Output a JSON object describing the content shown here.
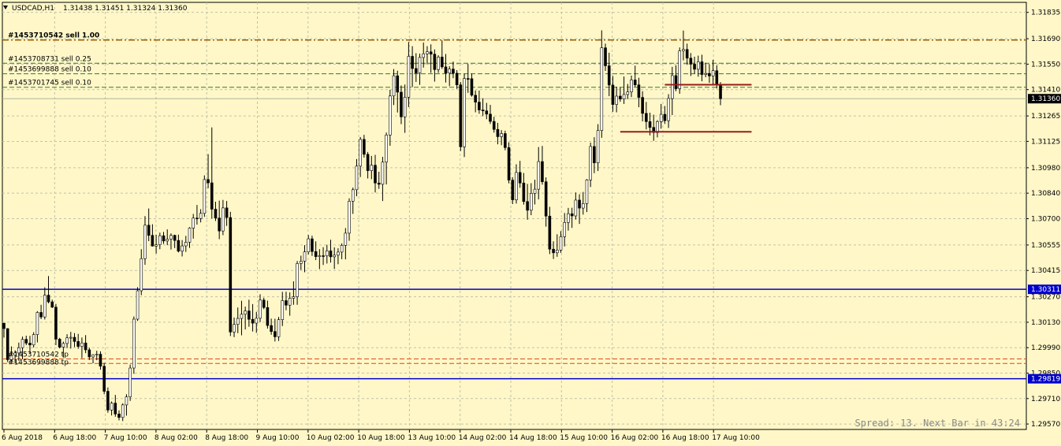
{
  "header": {
    "symbol_label": "USDCAD,H1",
    "ohlc_text": "1.31438 1.31451 1.31324 1.31360"
  },
  "status": {
    "spread_text": "Spread: 13. Next Bar in 43:24"
  },
  "colors": {
    "background": "#fff7c8",
    "grid": "#c2c2a8",
    "candle": "#000000",
    "support_line": "#0000cc",
    "sell_main_line": "#9a5a00",
    "sell_small_line": "#2f7d2f",
    "tp_line": "#d84a1a",
    "box_line": "#9b1b1b",
    "price_tag_blue": "#0000cc",
    "price_tag_black": "#000000"
  },
  "chart_data": {
    "type": "candlestick",
    "title": "USDCAD,H1",
    "ylim": [
      1.2954,
      1.3189
    ],
    "y_ticks": [
      "1.31835",
      "1.31690",
      "1.31550",
      "1.31410",
      "1.31265",
      "1.31125",
      "1.30980",
      "1.30840",
      "1.30700",
      "1.30555",
      "1.30415",
      "1.30270",
      "1.30130",
      "1.29990",
      "1.29850",
      "1.29710",
      "1.29570"
    ],
    "x_ticks": [
      "6 Aug 2018",
      "6 Aug 18:00",
      "7 Aug 10:00",
      "8 Aug 02:00",
      "8 Aug 18:00",
      "9 Aug 10:00",
      "10 Aug 02:00",
      "10 Aug 18:00",
      "13 Aug 10:00",
      "14 Aug 02:00",
      "14 Aug 18:00",
      "15 Aug 10:00",
      "16 Aug 02:00",
      "16 Aug 18:00",
      "17 Aug 10:00"
    ],
    "current_price": "1.31360",
    "horizontal_levels": [
      {
        "label": "",
        "price": 1.30311,
        "price_label": "1.30311",
        "kind": "support"
      },
      {
        "label": "",
        "price": 1.29819,
        "price_label": "1.29819",
        "kind": "support"
      },
      {
        "label": "#1453710542 sell 1.00",
        "price": 1.31683,
        "kind": "sell_main"
      },
      {
        "label": "#1453708731 sell 0.25",
        "price": 1.31555,
        "kind": "sell_small"
      },
      {
        "label": "#1453699888 sell 0.10",
        "price": 1.31497,
        "kind": "sell_small"
      },
      {
        "label": "#1453701745 sell 0.10",
        "price": 1.31423,
        "kind": "sell_small"
      },
      {
        "label": "#1453710542 tp",
        "price": 1.29928,
        "kind": "tp"
      },
      {
        "label": "#1453699888 tp",
        "price": 1.29903,
        "kind": "tp"
      }
    ],
    "segments": [
      {
        "x_start_bar": 178,
        "x_end_bar": 195,
        "price": 1.31437
      },
      {
        "x_start_bar": 166,
        "x_end_bar": 195,
        "price": 1.31178
      }
    ],
    "candles": [
      [
        1.30125,
        1.30115,
        1.30045,
        1.30095
      ],
      [
        1.30095,
        1.30097,
        1.29911,
        1.29924
      ],
      [
        1.29924,
        1.29997,
        1.29913,
        1.29949
      ],
      [
        1.29949,
        1.29975,
        1.29904,
        1.29961
      ],
      [
        1.29961,
        1.30018,
        1.29918,
        1.2999
      ],
      [
        1.2999,
        1.30051,
        1.29926,
        1.30036
      ],
      [
        1.30036,
        1.30056,
        1.30004,
        1.30015
      ],
      [
        1.30015,
        1.30055,
        1.29955,
        1.30005
      ],
      [
        1.30005,
        1.30075,
        1.29991,
        1.30062
      ],
      [
        1.30062,
        1.30191,
        1.30019,
        1.30184
      ],
      [
        1.30184,
        1.30226,
        1.30147,
        1.30159
      ],
      [
        1.30159,
        1.30322,
        1.30145,
        1.30279
      ],
      [
        1.30279,
        1.30384,
        1.30234,
        1.30242
      ],
      [
        1.30242,
        1.30254,
        1.30208,
        1.30213
      ],
      [
        1.30213,
        1.30231,
        1.30004,
        1.30037
      ],
      [
        1.30037,
        1.30044,
        1.29986,
        1.29993
      ],
      [
        1.29993,
        1.30023,
        1.29935,
        1.30013
      ],
      [
        1.30013,
        1.30064,
        1.29988,
        1.30044
      ],
      [
        1.30044,
        1.30077,
        1.29985,
        1.30047
      ],
      [
        1.30047,
        1.3007,
        1.29993,
        1.30024
      ],
      [
        1.30024,
        1.30066,
        1.29984,
        1.29997
      ],
      [
        1.29997,
        1.30046,
        1.29932,
        1.30016
      ],
      [
        1.30016,
        1.30059,
        1.2996,
        1.29978
      ],
      [
        1.29978,
        1.29989,
        1.29922,
        1.29939
      ],
      [
        1.29939,
        1.29954,
        1.29904,
        1.29951
      ],
      [
        1.29951,
        1.29973,
        1.29921,
        1.29954
      ],
      [
        1.29954,
        1.2997,
        1.29869,
        1.29888
      ],
      [
        1.29888,
        1.29906,
        1.29734,
        1.2975
      ],
      [
        1.2975,
        1.29771,
        1.29632,
        1.29647
      ],
      [
        1.29647,
        1.29694,
        1.29617,
        1.29685
      ],
      [
        1.29685,
        1.2973,
        1.2961,
        1.29625
      ],
      [
        1.29625,
        1.29645,
        1.2959,
        1.29606
      ],
      [
        1.29606,
        1.29684,
        1.29586,
        1.29675
      ],
      [
        1.29675,
        1.29734,
        1.29616,
        1.29719
      ],
      [
        1.29719,
        1.29897,
        1.29697,
        1.29878
      ],
      [
        1.29878,
        1.30162,
        1.29846,
        1.30147
      ],
      [
        1.30147,
        1.30323,
        1.30137,
        1.30303
      ],
      [
        1.30303,
        1.30532,
        1.30279,
        1.3048
      ],
      [
        1.3048,
        1.30714,
        1.30446,
        1.30664
      ],
      [
        1.30664,
        1.30756,
        1.30576,
        1.30608
      ],
      [
        1.30608,
        1.30669,
        1.30547,
        1.30549
      ],
      [
        1.30549,
        1.30611,
        1.30508,
        1.30556
      ],
      [
        1.30556,
        1.30623,
        1.30532,
        1.30606
      ],
      [
        1.30606,
        1.30627,
        1.30561,
        1.30577
      ],
      [
        1.30577,
        1.30641,
        1.30554,
        1.30587
      ],
      [
        1.30587,
        1.30619,
        1.3053,
        1.30608
      ],
      [
        1.30608,
        1.30612,
        1.30538,
        1.3058
      ],
      [
        1.3058,
        1.30612,
        1.30514,
        1.30521
      ],
      [
        1.30521,
        1.30582,
        1.30492,
        1.3055
      ],
      [
        1.3055,
        1.30605,
        1.30517,
        1.3057
      ],
      [
        1.3057,
        1.30653,
        1.30539,
        1.30648
      ],
      [
        1.30648,
        1.30726,
        1.3059,
        1.30703
      ],
      [
        1.30703,
        1.30775,
        1.30667,
        1.30701
      ],
      [
        1.30701,
        1.30752,
        1.30679,
        1.30729
      ],
      [
        1.30729,
        1.30938,
        1.3071,
        1.30915
      ],
      [
        1.30915,
        1.31055,
        1.30867,
        1.30897
      ],
      [
        1.30897,
        1.31202,
        1.30701,
        1.30752
      ],
      [
        1.30752,
        1.30793,
        1.30687,
        1.30703
      ],
      [
        1.30703,
        1.30799,
        1.30587,
        1.30632
      ],
      [
        1.30632,
        1.30803,
        1.30609,
        1.30759
      ],
      [
        1.30759,
        1.30797,
        1.3066,
        1.30706
      ],
      [
        1.30706,
        1.30738,
        1.30054,
        1.30076
      ],
      [
        1.30076,
        1.30156,
        1.30048,
        1.30118
      ],
      [
        1.30118,
        1.30211,
        1.3007,
        1.30151
      ],
      [
        1.30151,
        1.30248,
        1.30058,
        1.30174
      ],
      [
        1.30174,
        1.30216,
        1.3009,
        1.30192
      ],
      [
        1.30192,
        1.30254,
        1.30105,
        1.30146
      ],
      [
        1.30146,
        1.3023,
        1.30079,
        1.30125
      ],
      [
        1.30125,
        1.30187,
        1.30072,
        1.30152
      ],
      [
        1.30152,
        1.30284,
        1.30131,
        1.30252
      ],
      [
        1.30252,
        1.30265,
        1.30202,
        1.30211
      ],
      [
        1.30211,
        1.30249,
        1.30095,
        1.30112
      ],
      [
        1.30112,
        1.3015,
        1.30061,
        1.30079
      ],
      [
        1.30079,
        1.30149,
        1.30024,
        1.3005
      ],
      [
        1.3005,
        1.30159,
        1.30027,
        1.30144
      ],
      [
        1.30144,
        1.30297,
        1.30109,
        1.30249
      ],
      [
        1.30249,
        1.30298,
        1.30196,
        1.30224
      ],
      [
        1.30224,
        1.30294,
        1.30166,
        1.30262
      ],
      [
        1.30262,
        1.30355,
        1.30226,
        1.3027
      ],
      [
        1.3027,
        1.30467,
        1.30226,
        1.30453
      ],
      [
        1.30453,
        1.30496,
        1.30418,
        1.30466
      ],
      [
        1.30466,
        1.30554,
        1.30405,
        1.30517
      ],
      [
        1.30517,
        1.3061,
        1.30503,
        1.30589
      ],
      [
        1.30589,
        1.30606,
        1.30495,
        1.30519
      ],
      [
        1.30519,
        1.30575,
        1.30472,
        1.30491
      ],
      [
        1.30491,
        1.30532,
        1.30422,
        1.30496
      ],
      [
        1.30496,
        1.30543,
        1.30445,
        1.30495
      ],
      [
        1.30495,
        1.30556,
        1.30453,
        1.30523
      ],
      [
        1.30523,
        1.30584,
        1.30458,
        1.3049
      ],
      [
        1.3049,
        1.30542,
        1.30423,
        1.30499
      ],
      [
        1.30499,
        1.30537,
        1.30449,
        1.30516
      ],
      [
        1.30516,
        1.30564,
        1.30477,
        1.30553
      ],
      [
        1.30553,
        1.30648,
        1.30476,
        1.3062
      ],
      [
        1.3062,
        1.30812,
        1.30578,
        1.30796
      ],
      [
        1.30796,
        1.30871,
        1.30726,
        1.30859
      ],
      [
        1.30859,
        1.31028,
        1.30823,
        1.30989
      ],
      [
        1.30989,
        1.31149,
        1.30929,
        1.31136
      ],
      [
        1.31136,
        1.31161,
        1.31036,
        1.31054
      ],
      [
        1.31054,
        1.31067,
        1.30921,
        1.30964
      ],
      [
        1.30964,
        1.31045,
        1.30917,
        1.30994
      ],
      [
        1.30994,
        1.31051,
        1.30844,
        1.30896
      ],
      [
        1.30896,
        1.30958,
        1.30864,
        1.30889
      ],
      [
        1.30889,
        1.3104,
        1.30797,
        1.31011
      ],
      [
        1.31011,
        1.31174,
        1.30888,
        1.3116
      ],
      [
        1.3116,
        1.31409,
        1.31101,
        1.31375
      ],
      [
        1.31375,
        1.31523,
        1.31325,
        1.31486
      ],
      [
        1.31486,
        1.31514,
        1.31284,
        1.31396
      ],
      [
        1.31396,
        1.31433,
        1.3122,
        1.3126
      ],
      [
        1.3126,
        1.31438,
        1.31172,
        1.31368
      ],
      [
        1.31368,
        1.31672,
        1.31314,
        1.31593
      ],
      [
        1.31593,
        1.31649,
        1.31424,
        1.31526
      ],
      [
        1.31526,
        1.3161,
        1.31452,
        1.31502
      ],
      [
        1.31502,
        1.31608,
        1.31436,
        1.31587
      ],
      [
        1.31587,
        1.31669,
        1.31531,
        1.31607
      ],
      [
        1.31607,
        1.31649,
        1.31549,
        1.31618
      ],
      [
        1.31618,
        1.31659,
        1.31502,
        1.31605
      ],
      [
        1.31605,
        1.31631,
        1.31454,
        1.3152
      ],
      [
        1.3152,
        1.31599,
        1.31502,
        1.31589
      ],
      [
        1.31589,
        1.31681,
        1.31524,
        1.31535
      ],
      [
        1.31535,
        1.31606,
        1.31449,
        1.31501
      ],
      [
        1.31501,
        1.31539,
        1.31429,
        1.31523
      ],
      [
        1.31523,
        1.31564,
        1.31473,
        1.315
      ],
      [
        1.315,
        1.31517,
        1.31414,
        1.31436
      ],
      [
        1.31436,
        1.31452,
        1.31072,
        1.31095
      ],
      [
        1.31095,
        1.31498,
        1.31039,
        1.31471
      ],
      [
        1.31471,
        1.31551,
        1.31392,
        1.3147
      ],
      [
        1.3147,
        1.31498,
        1.31371,
        1.31379
      ],
      [
        1.31379,
        1.31405,
        1.31285,
        1.31341
      ],
      [
        1.31341,
        1.31405,
        1.31277,
        1.31298
      ],
      [
        1.31298,
        1.31362,
        1.31264,
        1.31293
      ],
      [
        1.31293,
        1.31337,
        1.31247,
        1.31275
      ],
      [
        1.31275,
        1.31326,
        1.31221,
        1.31235
      ],
      [
        1.31235,
        1.3126,
        1.31173,
        1.31191
      ],
      [
        1.31191,
        1.31227,
        1.31109,
        1.31151
      ],
      [
        1.31151,
        1.31187,
        1.31104,
        1.31168
      ],
      [
        1.31168,
        1.31184,
        1.31076,
        1.31091
      ],
      [
        1.31091,
        1.3112,
        1.30894,
        1.30912
      ],
      [
        1.30912,
        1.30928,
        1.3078,
        1.30803
      ],
      [
        1.30803,
        1.30999,
        1.30783,
        1.30954
      ],
      [
        1.30954,
        1.31018,
        1.3087,
        1.30896
      ],
      [
        1.30896,
        1.30951,
        1.30777,
        1.30794
      ],
      [
        1.30794,
        1.30891,
        1.30694,
        1.30746
      ],
      [
        1.30746,
        1.30895,
        1.30719,
        1.30839
      ],
      [
        1.30839,
        1.30914,
        1.30778,
        1.30862
      ],
      [
        1.30862,
        1.31094,
        1.30806,
        1.31014
      ],
      [
        1.31014,
        1.311,
        1.30887,
        1.30903
      ],
      [
        1.30903,
        1.30927,
        1.30656,
        1.30714
      ],
      [
        1.30714,
        1.30765,
        1.30505,
        1.30532
      ],
      [
        1.30532,
        1.30575,
        1.30478,
        1.30512
      ],
      [
        1.30512,
        1.30614,
        1.3049,
        1.30527
      ],
      [
        1.30527,
        1.30631,
        1.30512,
        1.30601
      ],
      [
        1.30601,
        1.30731,
        1.30547,
        1.30679
      ],
      [
        1.30679,
        1.30759,
        1.30634,
        1.30727
      ],
      [
        1.30727,
        1.3076,
        1.30649,
        1.30715
      ],
      [
        1.30715,
        1.30844,
        1.30695,
        1.30802
      ],
      [
        1.30802,
        1.30834,
        1.30671,
        1.30758
      ],
      [
        1.30758,
        1.30847,
        1.30722,
        1.30783
      ],
      [
        1.30783,
        1.30918,
        1.30736,
        1.30913
      ],
      [
        1.30913,
        1.31118,
        1.30874,
        1.31097
      ],
      [
        1.31097,
        1.31148,
        1.3095,
        1.31007
      ],
      [
        1.31007,
        1.3122,
        1.30962,
        1.31185
      ],
      [
        1.31185,
        1.31736,
        1.31145,
        1.3164
      ],
      [
        1.3164,
        1.31663,
        1.31513,
        1.31541
      ],
      [
        1.31541,
        1.31613,
        1.31374,
        1.31435
      ],
      [
        1.31435,
        1.31485,
        1.31288,
        1.31328
      ],
      [
        1.31328,
        1.31426,
        1.31285,
        1.31374
      ],
      [
        1.31374,
        1.31423,
        1.31343,
        1.31358
      ],
      [
        1.31358,
        1.31482,
        1.31331,
        1.31383
      ],
      [
        1.31383,
        1.31441,
        1.31359,
        1.31397
      ],
      [
        1.31397,
        1.31487,
        1.31369,
        1.31463
      ],
      [
        1.31463,
        1.31542,
        1.31425,
        1.31436
      ],
      [
        1.31436,
        1.31475,
        1.31313,
        1.31367
      ],
      [
        1.31367,
        1.31401,
        1.31235,
        1.31279
      ],
      [
        1.31279,
        1.31342,
        1.31191,
        1.31234
      ],
      [
        1.31234,
        1.31283,
        1.31158,
        1.31202
      ],
      [
        1.31202,
        1.31272,
        1.31128,
        1.31174
      ],
      [
        1.31174,
        1.31242,
        1.31147,
        1.31234
      ],
      [
        1.31234,
        1.31331,
        1.31195,
        1.31274
      ],
      [
        1.31274,
        1.3132,
        1.31221,
        1.31239
      ],
      [
        1.31239,
        1.31385,
        1.31199,
        1.31361
      ],
      [
        1.31361,
        1.31535,
        1.3127,
        1.31487
      ],
      [
        1.31487,
        1.31544,
        1.31401,
        1.31415
      ],
      [
        1.31415,
        1.31642,
        1.31387,
        1.31623
      ],
      [
        1.31623,
        1.31735,
        1.31571,
        1.31631
      ],
      [
        1.31631,
        1.31663,
        1.31546,
        1.31583
      ],
      [
        1.31583,
        1.31611,
        1.31485,
        1.3155
      ],
      [
        1.3155,
        1.31591,
        1.31497,
        1.31522
      ],
      [
        1.31522,
        1.31597,
        1.31481,
        1.31563
      ],
      [
        1.31563,
        1.31602,
        1.31456,
        1.31493
      ],
      [
        1.31493,
        1.31557,
        1.31478,
        1.31499
      ],
      [
        1.31499,
        1.3155,
        1.31447,
        1.31485
      ],
      [
        1.31485,
        1.31574,
        1.31432,
        1.31514
      ],
      [
        1.31514,
        1.31544,
        1.31416,
        1.31438
      ],
      [
        1.31438,
        1.31451,
        1.31324,
        1.3136
      ]
    ]
  }
}
